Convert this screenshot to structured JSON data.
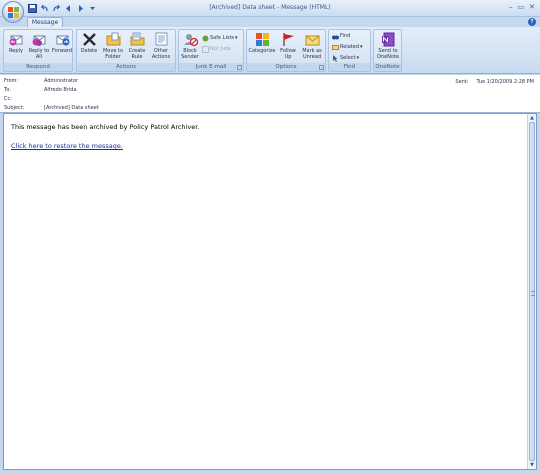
{
  "window": {
    "title": "[Archived] Data sheet - Message (HTML)",
    "minimize_glyph": "–",
    "maximize_glyph": "▭",
    "close_glyph": "✕"
  },
  "tabs": [
    {
      "label": "Message"
    }
  ],
  "help_glyph": "?",
  "ribbon": {
    "respond": {
      "label": "Respond",
      "reply": "Reply",
      "reply_all": "Reply to All",
      "forward": "Forward"
    },
    "actions": {
      "label": "Actions",
      "delete": "Delete",
      "move_to_folder": "Move to Folder",
      "create_rule": "Create Rule",
      "other_actions": "Other Actions"
    },
    "junk": {
      "label": "Junk E-mail",
      "block_sender": "Block Sender",
      "safe_lists": "Safe Lists",
      "not_junk": "Not Junk"
    },
    "options": {
      "label": "Options",
      "categorize": "Categorize",
      "follow_up": "Follow Up",
      "mark_unread": "Mark as Unread"
    },
    "find": {
      "label": "Find",
      "find": "Find",
      "related": "Related",
      "select": "Select"
    },
    "onenote": {
      "label": "OneNote",
      "send_to_onenote": "Send to OneNote"
    }
  },
  "headers": {
    "from_label": "From:",
    "from_value": "Administrator",
    "to_label": "To:",
    "to_value": "Alfredo Brida",
    "cc_label": "Cc:",
    "cc_value": "",
    "subject_label": "Subject:",
    "subject_value": "[Archived] Data sheet",
    "sent_label": "Sent:",
    "sent_value": "Tue 1/20/2009 2:28 PM"
  },
  "message": {
    "body_text": "This message has been archived by Policy Patrol Archiver.",
    "restore_link": "Click here to restore the message."
  },
  "colors": {
    "ribbon_bg": "#d6e4f5",
    "accent": "#15428b",
    "link": "#1a2e9e"
  }
}
